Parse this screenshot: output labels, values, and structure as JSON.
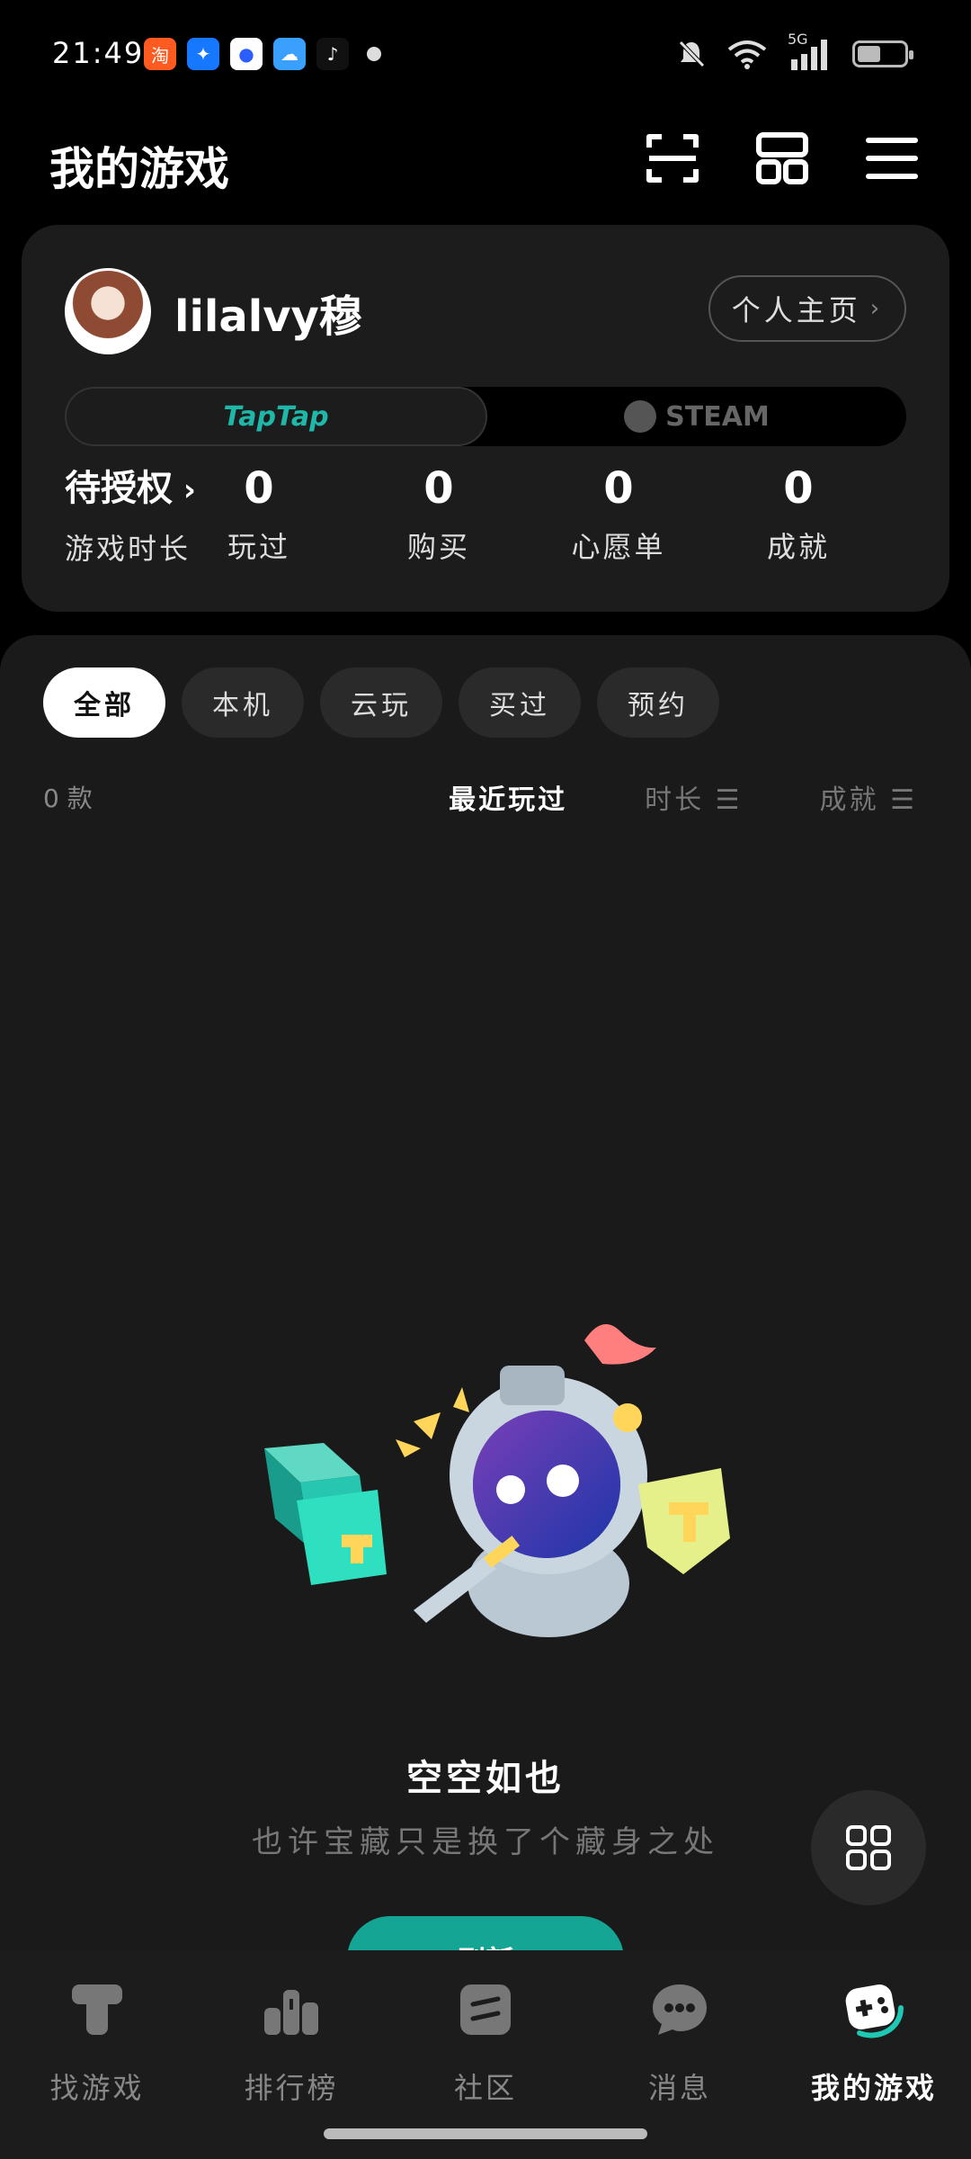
{
  "status_bar": {
    "time": "21:49",
    "network": "5G",
    "battery_level": 0.44,
    "app_icons": [
      "taobao-icon",
      "alipay-icon",
      "baidu-icon",
      "weather-icon",
      "tiktok-icon"
    ]
  },
  "header": {
    "title": "我的游戏",
    "icons": [
      "scan-icon",
      "grid-layout-icon",
      "menu-icon"
    ]
  },
  "profile": {
    "username": "lilalvy穆",
    "homepage_label": "个人主页",
    "platform_tabs": [
      "TapTap",
      "STEAM"
    ],
    "active_platform": "TapTap",
    "stats": [
      {
        "value": "待授权",
        "label": "游戏时长"
      },
      {
        "value": "0",
        "label": "玩过"
      },
      {
        "value": "0",
        "label": "购买"
      },
      {
        "value": "0",
        "label": "心愿单"
      },
      {
        "value": "0",
        "label": "成就"
      }
    ]
  },
  "filters": {
    "chips": [
      "全部",
      "本机",
      "云玩",
      "买过",
      "预约"
    ],
    "active_chip": "全部",
    "count_label": "0 款",
    "sorts": [
      "最近玩过",
      "时长",
      "成就"
    ],
    "active_sort": "最近玩过"
  },
  "empty_state": {
    "title": "空空如也",
    "subtitle": "也许宝藏只是换了个藏身之处",
    "button_label": "刷新"
  },
  "bottom_nav": {
    "items": [
      "找游戏",
      "排行榜",
      "社区",
      "消息",
      "我的游戏"
    ],
    "active": "我的游戏"
  },
  "colors": {
    "accent": "#14a594",
    "background": "#000000",
    "card": "#1c1c1c"
  }
}
